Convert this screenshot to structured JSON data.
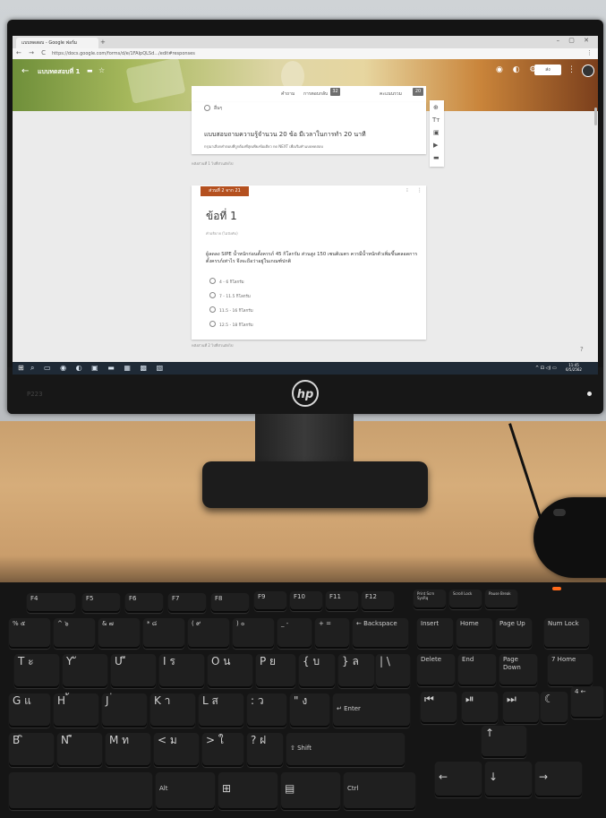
{
  "browser": {
    "tab_title": "แบบทดสอบ - Google ฟอร์ม",
    "new_tab": "+",
    "window_controls": "– ▢ ✕",
    "nav_icons": "← → C",
    "url": "https://docs.google.com/forms/d/e/1FAIpQLSd.../edit#responses",
    "menu_icon": "⋮"
  },
  "forms_header": {
    "back": "←",
    "title": "แบบทดสอบที่ 1",
    "folder": "▬",
    "star": "☆",
    "icons": "◉ ◐ ⚙",
    "send": "ส่ง",
    "more": "⋮"
  },
  "tabs": {
    "questions": "คำถาม",
    "responses": "การตอบกลับ",
    "responses_count": "32",
    "score_label": "คะแนนรวม",
    "score_value": "20"
  },
  "card1": {
    "option": "อื่นๆ",
    "heading": "แบบสอบถามความรู้จำนวน 20 ข้อ มีเวลาในการทำ 20 นาที",
    "description": "กรุณาเลือกคำตอบที่ถูกต้องที่สุดเพียงข้อเดียว กด NEXT เพื่อเริ่มทำแบบทดสอบ",
    "meta": "หลังส่วนที่ 1 ไปที่ส่วนถัดไป"
  },
  "toolbar": [
    "⊕",
    "Tт",
    "▣",
    "▶",
    "▬"
  ],
  "section": {
    "badge": "ส่วนที่ 2 จาก 21",
    "card_icons": "⁝ ⋮",
    "title": "ข้อที่ 1",
    "description": "คำอธิบาย (ไม่บังคับ)",
    "question": "ผู้ลดลง SIPE น้ำหนักก่อนตั้งครรภ์ 45 กิโลกรัม ส่วนสูง 150 เซนติเมตร ควรมีน้ำหนักตัวเพิ่มขึ้นตลอดการตั้งครรภ์เท่าไร จึงจะถือว่าอยู่ในเกณฑ์ปกติ",
    "options": [
      "4 - 6 กิโลกรัม",
      "7 - 11.5 กิโลกรัม",
      "11.5 - 16 กิโลกรัม",
      "12.5 - 18 กิโลกรัม"
    ],
    "meta": "หลังส่วนที่ 2 ไปที่ส่วนถัดไป"
  },
  "help": "?",
  "taskbar": {
    "start": "⊞",
    "icons": "⌕ ▭ ◉ ◐ ▣ ▬ ▦ ▩ ▧",
    "tray": "^ ⊡ ◁) ▭",
    "clock_time": "11:45",
    "clock_date": "6/5/2562"
  },
  "monitor": {
    "logo": "hp",
    "model": "P223"
  },
  "keyboard": {
    "row_f": [
      "F4",
      "F5",
      "F6",
      "F7",
      "F8",
      "F9",
      "F10",
      "F11",
      "F12",
      "Print Scrn SysRq",
      "Scroll Lock",
      "Pause Break"
    ],
    "row_num": [
      "% ๕",
      "^ ๖",
      "& ๗",
      "* ๘",
      "( ๙",
      ") ๐",
      "_ -",
      "+ =",
      "← Backspace",
      "Insert",
      "Home",
      "Page Up",
      "Num Lock"
    ],
    "row_top": [
      "T ะ",
      "Y ั",
      "U ี",
      "I ร",
      "O น",
      "P ย",
      "{ บ",
      "} ล",
      "| \\",
      "Delete",
      "End",
      "Page Down",
      "7 Home"
    ],
    "row_mid": [
      "G แ",
      "H ้",
      "J ่",
      "K า",
      "L ส",
      ": ว",
      "\" ง",
      "↵ Enter",
      "⏮",
      "⏯",
      "⏭",
      "☾",
      "4 ←"
    ],
    "row_low": [
      "B ิ",
      "N ื",
      "M ท",
      "< ม",
      "> ใ",
      "? ฝ",
      "⇧ Shift",
      "↑"
    ],
    "row_bottom": [
      "Alt",
      "⊞",
      "▤",
      "Ctrl",
      "←",
      "↓",
      "→"
    ]
  }
}
